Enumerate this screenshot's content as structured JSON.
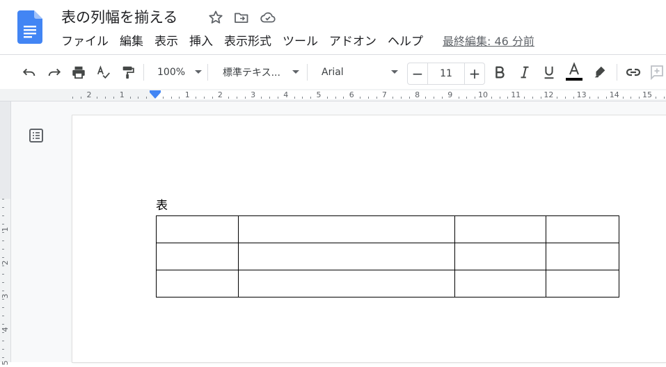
{
  "app": {
    "title": "表の列幅を揃える"
  },
  "menu": {
    "items": [
      "ファイル",
      "編集",
      "表示",
      "挿入",
      "表示形式",
      "ツール",
      "アドオン",
      "ヘルプ"
    ],
    "last_edit": "最終編集: 46 分前"
  },
  "toolbar": {
    "zoom": "100%",
    "style": "標準テキス...",
    "font": "Arial",
    "font_size": "11",
    "minus": "−",
    "plus": "+"
  },
  "ruler": {
    "numbers": [
      "2",
      "1",
      "1",
      "2",
      "3",
      "4",
      "5",
      "6",
      "7",
      "8",
      "9",
      "10",
      "11",
      "12",
      "13",
      "14",
      "15"
    ],
    "vertical_numbers": [
      "1",
      "2",
      "3",
      "4",
      "5"
    ]
  },
  "document": {
    "text": "表",
    "table": {
      "rows": 3,
      "cols": 4,
      "cells": [
        [
          "",
          "",
          "",
          ""
        ],
        [
          "",
          "",
          "",
          ""
        ],
        [
          "",
          "",
          "",
          ""
        ]
      ]
    }
  },
  "colors": {
    "docs_blue": "#4285f4",
    "text_color_bar": "#000000",
    "toolbar_icon": "#444746"
  },
  "icons": [
    "docs-logo-icon",
    "star-icon",
    "move-to-folder-icon",
    "cloud-saved-icon",
    "undo-icon",
    "redo-icon",
    "print-icon",
    "spellcheck-icon",
    "paint-format-icon",
    "bold-icon",
    "italic-icon",
    "underline-icon",
    "text-color-icon",
    "highlight-icon",
    "link-icon",
    "add-comment-icon",
    "outline-icon"
  ]
}
